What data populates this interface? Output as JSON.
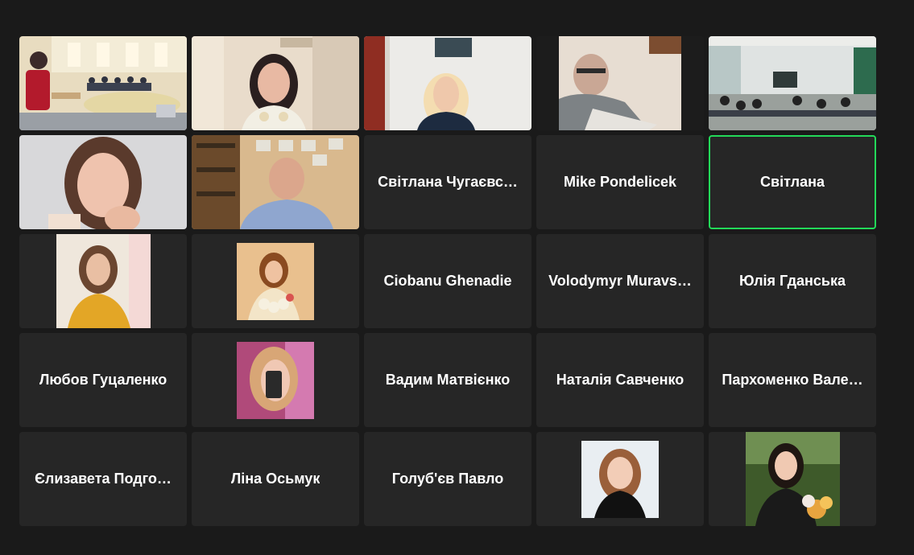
{
  "tiles": [
    {
      "id": "video-1",
      "name": "",
      "kind": "video"
    },
    {
      "id": "video-2",
      "name": "",
      "kind": "video"
    },
    {
      "id": "video-3",
      "name": "",
      "kind": "video"
    },
    {
      "id": "video-4",
      "name": "",
      "kind": "video"
    },
    {
      "id": "video-5",
      "name": "",
      "kind": "video"
    },
    {
      "id": "video-6",
      "name": "",
      "kind": "video"
    },
    {
      "id": "video-7",
      "name": "",
      "kind": "video"
    },
    {
      "name": "Світлана Чугаєвс…"
    },
    {
      "name": "Mike Pondelicek"
    },
    {
      "name": "Світлана",
      "active": true
    },
    {
      "name": "",
      "kind": "avatar"
    },
    {
      "name": "",
      "kind": "avatar"
    },
    {
      "name": "Ciobanu Ghenadie"
    },
    {
      "name": "Volodymyr Muravs…"
    },
    {
      "name": "Юлія Гданська"
    },
    {
      "name": "Любов Гуцаленко"
    },
    {
      "name": "",
      "kind": "avatar"
    },
    {
      "name": "Вадим Матвієнко"
    },
    {
      "name": "Наталія Савченко"
    },
    {
      "name": "Пархоменко Вале…"
    },
    {
      "name": "Єлизавета Подго…"
    },
    {
      "name": "Ліна Осьмук"
    },
    {
      "name": "Голуб'єв Павло"
    },
    {
      "name": "",
      "kind": "avatar"
    },
    {
      "name": "",
      "kind": "avatar"
    }
  ],
  "colors": {
    "background": "#1a1a1a",
    "tile": "#262626",
    "active_border": "#23d959",
    "name_text": "#ffffff"
  }
}
